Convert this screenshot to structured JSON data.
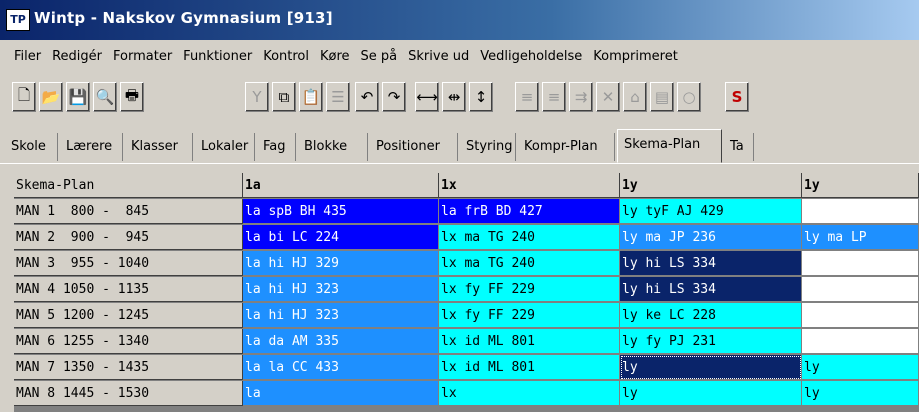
{
  "window": {
    "title": "Wintp - Nakskov Gymnasium [913]",
    "app_icon": "TP"
  },
  "menu": [
    "Filer",
    "Redigér",
    "Formater",
    "Funktioner",
    "Kontrol",
    "Køre",
    "Se på",
    "Skrive ud",
    "Vedligeholdelse",
    "Komprimeret"
  ],
  "toolbar": {
    "groups": [
      {
        "buttons": [
          {
            "icon": "new-document-icon",
            "glyph": "🗋",
            "disabled": false
          },
          {
            "icon": "open-folder-icon",
            "glyph": "📂",
            "disabled": false
          },
          {
            "icon": "save-icon",
            "glyph": "💾",
            "disabled": false
          },
          {
            "icon": "search-icon",
            "glyph": "🔍",
            "disabled": false
          },
          {
            "icon": "print-icon",
            "glyph": "🖶",
            "disabled": false
          }
        ]
      },
      {
        "buttons": [
          {
            "icon": "filter-icon",
            "glyph": "Y",
            "disabled": true
          },
          {
            "icon": "copy-icon",
            "glyph": "⧉",
            "disabled": false
          },
          {
            "icon": "paste-icon",
            "glyph": "📋",
            "disabled": true
          },
          {
            "icon": "list-icon",
            "glyph": "☰",
            "disabled": true
          }
        ]
      },
      {
        "buttons": [
          {
            "icon": "undo-icon",
            "glyph": "↶",
            "disabled": false
          },
          {
            "icon": "redo-icon",
            "glyph": "↷",
            "disabled": false
          }
        ]
      },
      {
        "buttons": [
          {
            "icon": "fit-width-icon",
            "glyph": "⟷",
            "disabled": false
          },
          {
            "icon": "fit-columns-icon",
            "glyph": "⇹",
            "disabled": false
          },
          {
            "icon": "fit-height-icon",
            "glyph": "↕",
            "disabled": false
          }
        ]
      },
      {
        "buttons": [
          {
            "icon": "tool-a-icon",
            "glyph": "≡",
            "disabled": true
          },
          {
            "icon": "tool-b-icon",
            "glyph": "≡",
            "disabled": true
          },
          {
            "icon": "tool-c-icon",
            "glyph": "⇉",
            "disabled": true
          },
          {
            "icon": "delete-icon",
            "glyph": "✕",
            "disabled": true
          },
          {
            "icon": "home-icon",
            "glyph": "⌂",
            "disabled": true
          },
          {
            "icon": "document-icon",
            "glyph": "▤",
            "disabled": true
          },
          {
            "icon": "circle-icon",
            "glyph": "○",
            "disabled": true
          }
        ]
      },
      {
        "buttons": [
          {
            "icon": "schedule-icon",
            "glyph": "S",
            "disabled": false
          }
        ]
      }
    ]
  },
  "tabs": [
    {
      "label": "Skole",
      "active": false
    },
    {
      "label": "Lærere",
      "active": false
    },
    {
      "label": "Klasser",
      "active": false
    },
    {
      "label": "Lokaler",
      "active": false
    },
    {
      "label": "Fag",
      "active": false
    },
    {
      "label": "Blokke",
      "active": false
    },
    {
      "label": "Positioner",
      "active": false
    },
    {
      "label": "Styring",
      "active": false
    },
    {
      "label": "Kompr-Plan",
      "active": false
    },
    {
      "label": "Skema-Plan",
      "active": true
    },
    {
      "label": "Ta",
      "active": false
    }
  ],
  "grid": {
    "corner": "Skema-Plan",
    "columns": [
      "1a",
      "1x",
      "1y",
      "1y"
    ],
    "rows": [
      {
        "label": "MAN 1  800 -  845",
        "cells": [
          {
            "text": "la spB BH 435",
            "color": "blue"
          },
          {
            "text": "la frB BD 427",
            "color": "blue"
          },
          {
            "text": "ly tyF AJ 429",
            "color": "cyan"
          },
          {
            "text": "",
            "color": "white"
          }
        ]
      },
      {
        "label": "MAN 2  900 -  945",
        "cells": [
          {
            "text": "la bi LC 224",
            "color": "blue"
          },
          {
            "text": "lx ma TG 240",
            "color": "cyan"
          },
          {
            "text": "ly ma JP 236",
            "color": "light"
          },
          {
            "text": "ly ma LP",
            "color": "light"
          }
        ]
      },
      {
        "label": "MAN 3  955 - 1040",
        "cells": [
          {
            "text": "la hi HJ 329",
            "color": "light"
          },
          {
            "text": "lx ma TG 240",
            "color": "cyan"
          },
          {
            "text": "ly hi LS 334",
            "color": "dark"
          },
          {
            "text": "",
            "color": "white"
          }
        ]
      },
      {
        "label": "MAN 4 1050 - 1135",
        "cells": [
          {
            "text": "la hi HJ 323",
            "color": "light"
          },
          {
            "text": "lx fy FF 229",
            "color": "cyan"
          },
          {
            "text": "ly hi LS 334",
            "color": "dark"
          },
          {
            "text": "",
            "color": "white"
          }
        ]
      },
      {
        "label": "MAN 5 1200 - 1245",
        "cells": [
          {
            "text": "la hi HJ 323",
            "color": "light"
          },
          {
            "text": "lx fy FF 229",
            "color": "cyan"
          },
          {
            "text": "ly ke LC 228",
            "color": "cyan"
          },
          {
            "text": "",
            "color": "white"
          }
        ]
      },
      {
        "label": "MAN 6 1255 - 1340",
        "cells": [
          {
            "text": "la da AM 335",
            "color": "light"
          },
          {
            "text": "lx id ML 801",
            "color": "cyan"
          },
          {
            "text": "ly fy PJ 231",
            "color": "cyan"
          },
          {
            "text": "",
            "color": "white"
          }
        ]
      },
      {
        "label": "MAN 7 1350 - 1435",
        "cells": [
          {
            "text": "la la CC 433",
            "color": "light"
          },
          {
            "text": "lx id ML 801",
            "color": "cyan"
          },
          {
            "text": "ly",
            "color": "dark",
            "focus": true
          },
          {
            "text": "ly",
            "color": "cyan"
          }
        ]
      },
      {
        "label": "MAN 8 1445 - 1530",
        "cells": [
          {
            "text": "la",
            "color": "light"
          },
          {
            "text": "lx",
            "color": "cyan"
          },
          {
            "text": "ly",
            "color": "cyan"
          },
          {
            "text": "ly",
            "color": "cyan"
          }
        ]
      }
    ]
  }
}
